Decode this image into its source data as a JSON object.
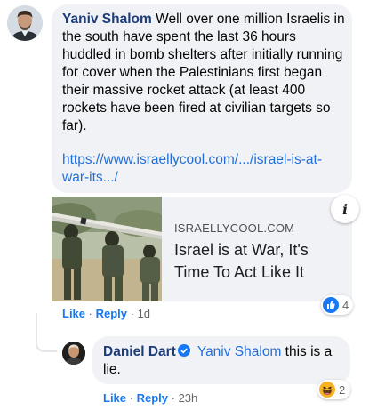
{
  "comment1": {
    "author": "Yaniv Shalom",
    "text": "Well over one million Israelis in the south have spent the last 36 hours huddled in bomb shelters after initially running for cover when the Palestinians first began their massive rocket attack (at least 400 rockets have been fired at civilian targets so far).",
    "link_text": "https://www.israellycool.com/.../israel-is-at-war-its.../",
    "actions": {
      "like": "Like",
      "reply": "Reply",
      "time": "1d"
    },
    "reactions": {
      "icon": "like-icon",
      "count": "4"
    }
  },
  "link_card": {
    "site": "ISRAELLYCOOL.COM",
    "title": "Israel is at War, It's Time To Act Like It",
    "info_symbol": "i"
  },
  "comment2": {
    "author": "Daniel Dart",
    "mention": "Yaniv Shalom",
    "text": "this is a lie.",
    "actions": {
      "like": "Like",
      "reply": "Reply",
      "time": "23h"
    },
    "reactions": {
      "icon": "haha-icon",
      "count": "2"
    }
  },
  "colors": {
    "bubble": "#f0f2f5",
    "author": "#1d3c78",
    "link": "#216fdb",
    "action": "#1877f2",
    "meta": "#65676b"
  }
}
